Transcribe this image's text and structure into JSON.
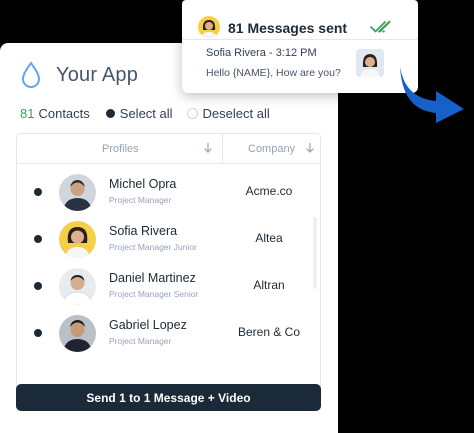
{
  "app": {
    "title": "Your App"
  },
  "contacts_bar": {
    "count": "81",
    "count_label": "Contacts",
    "select_all": "Select all",
    "deselect_all": "Deselect all"
  },
  "table": {
    "headers": {
      "profiles": "Profiles",
      "company": "Company"
    },
    "rows": [
      {
        "name": "Michel Opra",
        "role": "Project Manager",
        "company": "Acme.co"
      },
      {
        "name": "Sofia Rivera",
        "role": "Project Manager Junior",
        "company": "Altea"
      },
      {
        "name": "Daniel Martinez",
        "role": "Project Manager Senior",
        "company": "Altran"
      },
      {
        "name": "Gabriel Lopez",
        "role": "Project Manager",
        "company": "Beren & Co"
      }
    ]
  },
  "actions": {
    "send_label": "Send 1 to 1 Message + Video"
  },
  "notification": {
    "title": "81 Messages sent",
    "sender": "Sofia Rivera - 3:12 PM",
    "message": "Hello {NAME}, How are you?"
  },
  "colors": {
    "accent_green": "#3aa35c",
    "dark_navy": "#1b2a38",
    "arrow_blue": "#1560c9",
    "check_green": "#3aa35c"
  },
  "icons": [
    "water-drop-icon",
    "sort-down-icon",
    "double-check-icon",
    "curved-arrow-icon"
  ]
}
